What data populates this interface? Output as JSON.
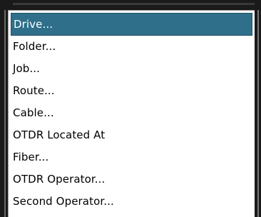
{
  "menu": {
    "items": [
      {
        "label": "Drive...",
        "selected": true
      },
      {
        "label": "Folder...",
        "selected": false
      },
      {
        "label": "Job...",
        "selected": false
      },
      {
        "label": "Route...",
        "selected": false
      },
      {
        "label": "Cable...",
        "selected": false
      },
      {
        "label": "OTDR Located At",
        "selected": false
      },
      {
        "label": "Fiber...",
        "selected": false
      },
      {
        "label": "OTDR Operator...",
        "selected": false
      },
      {
        "label": "Second Operator...",
        "selected": false
      }
    ]
  },
  "colors": {
    "selection_background": "#2f6f8a",
    "selection_text": "#ffffff",
    "frame": "#1a1a1a"
  }
}
